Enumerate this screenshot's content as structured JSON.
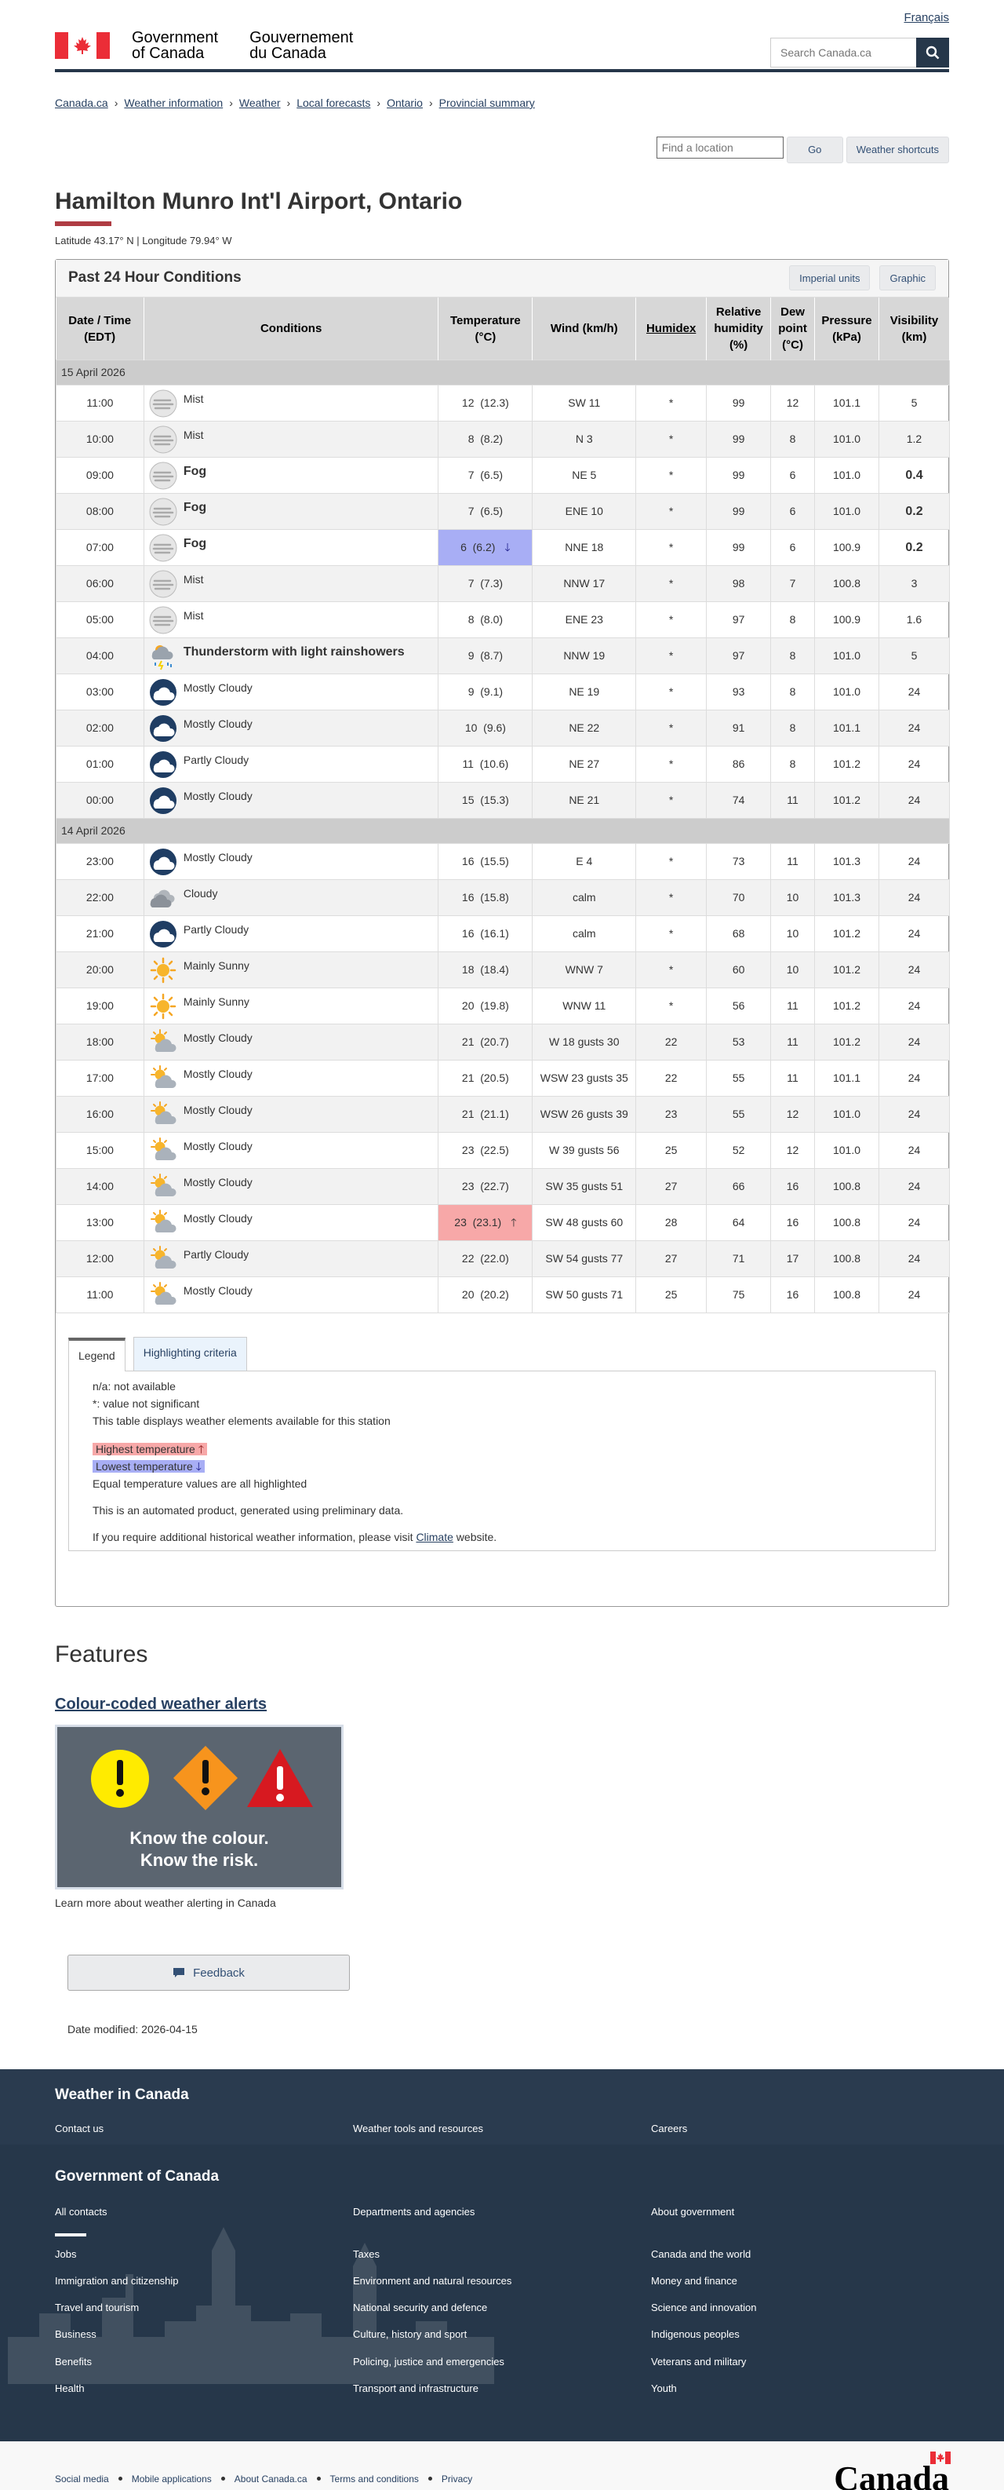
{
  "header": {
    "lang_link": "Français",
    "gov_en_1": "Government",
    "gov_en_2": "of Canada",
    "gov_fr_1": "Gouvernement",
    "gov_fr_2": "du Canada",
    "search_placeholder": "Search Canada.ca"
  },
  "breadcrumb": [
    "Canada.ca",
    "Weather information",
    "Weather",
    "Local forecasts",
    "Ontario",
    "Provincial summary"
  ],
  "location_bar": {
    "placeholder": "Find a location",
    "go": "Go",
    "shortcuts": "Weather shortcuts"
  },
  "page": {
    "title": "Hamilton Munro Int'l Airport, Ontario",
    "latlon": "Latitude 43.17° N | Longitude 79.94° W"
  },
  "panel": {
    "title": "Past 24 Hour Conditions",
    "imperial": "Imperial units",
    "graphic": "Graphic"
  },
  "table": {
    "headers": [
      "Date / Time (EDT)",
      "Conditions",
      "Temperature (°C)",
      "Wind (km/h)",
      "Humidex",
      "Relative humidity (%)",
      "Dew point (°C)",
      "Pressure (kPa)",
      "Visibility (km)"
    ],
    "groups": [
      {
        "date": "15 April 2026",
        "rows": [
          {
            "time": "11:00",
            "icon": "mist",
            "cond": "Mist",
            "bold": false,
            "temp": "12  (12.3)",
            "wind": "SW 11",
            "hx": "*",
            "rh": "99",
            "dew": "12",
            "pres": "101.1",
            "vis": "5",
            "vb": false
          },
          {
            "time": "10:00",
            "icon": "mist",
            "cond": "Mist",
            "bold": false,
            "temp": "8  (8.2)",
            "wind": "N 3",
            "hx": "*",
            "rh": "99",
            "dew": "8",
            "pres": "101.0",
            "vis": "1.2",
            "vb": false
          },
          {
            "time": "09:00",
            "icon": "mist",
            "cond": "Fog",
            "bold": true,
            "temp": "7  (6.5)",
            "wind": "NE 5",
            "hx": "*",
            "rh": "99",
            "dew": "6",
            "pres": "101.0",
            "vis": "0.4",
            "vb": true
          },
          {
            "time": "08:00",
            "icon": "mist",
            "cond": "Fog",
            "bold": true,
            "temp": "7  (6.5)",
            "wind": "ENE 10",
            "hx": "*",
            "rh": "99",
            "dew": "6",
            "pres": "101.0",
            "vis": "0.2",
            "vb": true
          },
          {
            "time": "07:00",
            "icon": "mist",
            "cond": "Fog",
            "bold": true,
            "temp": "6  (6.2)",
            "mark": "lo",
            "wind": "NNE 18",
            "hx": "*",
            "rh": "99",
            "dew": "6",
            "pres": "100.9",
            "vis": "0.2",
            "vb": true
          },
          {
            "time": "06:00",
            "icon": "mist",
            "cond": "Mist",
            "bold": false,
            "temp": "7  (7.3)",
            "wind": "NNW 17",
            "hx": "*",
            "rh": "98",
            "dew": "7",
            "pres": "100.8",
            "vis": "3",
            "vb": false
          },
          {
            "time": "05:00",
            "icon": "mist",
            "cond": "Mist",
            "bold": false,
            "temp": "8  (8.0)",
            "wind": "ENE 23",
            "hx": "*",
            "rh": "97",
            "dew": "8",
            "pres": "100.9",
            "vis": "1.6",
            "vb": false
          },
          {
            "time": "04:00",
            "icon": "storm",
            "cond": "Thunderstorm with light rainshowers",
            "bold": true,
            "temp": "9  (8.7)",
            "wind": "NNW 19",
            "hx": "*",
            "rh": "97",
            "dew": "8",
            "pres": "101.0",
            "vis": "5",
            "vb": false
          },
          {
            "time": "03:00",
            "icon": "night-cloudy",
            "cond": "Mostly Cloudy",
            "bold": false,
            "temp": "9  (9.1)",
            "wind": "NE 19",
            "hx": "*",
            "rh": "93",
            "dew": "8",
            "pres": "101.0",
            "vis": "24",
            "vb": false
          },
          {
            "time": "02:00",
            "icon": "night-cloudy",
            "cond": "Mostly Cloudy",
            "bold": false,
            "temp": "10  (9.6)",
            "wind": "NE 22",
            "hx": "*",
            "rh": "91",
            "dew": "8",
            "pres": "101.1",
            "vis": "24",
            "vb": false
          },
          {
            "time": "01:00",
            "icon": "night-cloudy",
            "cond": "Partly Cloudy",
            "bold": false,
            "temp": "11  (10.6)",
            "wind": "NE 27",
            "hx": "*",
            "rh": "86",
            "dew": "8",
            "pres": "101.2",
            "vis": "24",
            "vb": false
          },
          {
            "time": "00:00",
            "icon": "night-cloudy",
            "cond": "Mostly Cloudy",
            "bold": false,
            "temp": "15  (15.3)",
            "wind": "NE 21",
            "hx": "*",
            "rh": "74",
            "dew": "11",
            "pres": "101.2",
            "vis": "24",
            "vb": false
          }
        ]
      },
      {
        "date": "14 April 2026",
        "rows": [
          {
            "time": "23:00",
            "icon": "night-cloudy",
            "cond": "Mostly Cloudy",
            "bold": false,
            "temp": "16  (15.5)",
            "wind": "E 4",
            "hx": "*",
            "rh": "73",
            "dew": "11",
            "pres": "101.3",
            "vis": "24",
            "vb": false
          },
          {
            "time": "22:00",
            "icon": "cloudy",
            "cond": "Cloudy",
            "bold": false,
            "temp": "16  (15.8)",
            "wind": "calm",
            "hx": "*",
            "rh": "70",
            "dew": "10",
            "pres": "101.3",
            "vis": "24",
            "vb": false
          },
          {
            "time": "21:00",
            "icon": "night-cloudy",
            "cond": "Partly Cloudy",
            "bold": false,
            "temp": "16  (16.1)",
            "wind": "calm",
            "hx": "*",
            "rh": "68",
            "dew": "10",
            "pres": "101.2",
            "vis": "24",
            "vb": false
          },
          {
            "time": "20:00",
            "icon": "sunny",
            "cond": "Mainly Sunny",
            "bold": false,
            "temp": "18  (18.4)",
            "wind": "WNW 7",
            "hx": "*",
            "rh": "60",
            "dew": "10",
            "pres": "101.2",
            "vis": "24",
            "vb": false
          },
          {
            "time": "19:00",
            "icon": "sunny",
            "cond": "Mainly Sunny",
            "bold": false,
            "temp": "20  (19.8)",
            "wind": "WNW 11",
            "hx": "*",
            "rh": "56",
            "dew": "11",
            "pres": "101.2",
            "vis": "24",
            "vb": false
          },
          {
            "time": "18:00",
            "icon": "sun-cloud",
            "cond": "Mostly Cloudy",
            "bold": false,
            "temp": "21  (20.7)",
            "wind": "W 18 gusts 30",
            "hx": "22",
            "rh": "53",
            "dew": "11",
            "pres": "101.2",
            "vis": "24",
            "vb": false
          },
          {
            "time": "17:00",
            "icon": "sun-cloud",
            "cond": "Mostly Cloudy",
            "bold": false,
            "temp": "21  (20.5)",
            "wind": "WSW 23 gusts 35",
            "hx": "22",
            "rh": "55",
            "dew": "11",
            "pres": "101.1",
            "vis": "24",
            "vb": false
          },
          {
            "time": "16:00",
            "icon": "sun-cloud",
            "cond": "Mostly Cloudy",
            "bold": false,
            "temp": "21  (21.1)",
            "wind": "WSW 26 gusts 39",
            "hx": "23",
            "rh": "55",
            "dew": "12",
            "pres": "101.0",
            "vis": "24",
            "vb": false
          },
          {
            "time": "15:00",
            "icon": "sun-cloud",
            "cond": "Mostly Cloudy",
            "bold": false,
            "temp": "23  (22.5)",
            "wind": "W 39 gusts 56",
            "hx": "25",
            "rh": "52",
            "dew": "12",
            "pres": "101.0",
            "vis": "24",
            "vb": false
          },
          {
            "time": "14:00",
            "icon": "sun-cloud",
            "cond": "Mostly Cloudy",
            "bold": false,
            "temp": "23  (22.7)",
            "wind": "SW 35 gusts 51",
            "hx": "27",
            "rh": "66",
            "dew": "16",
            "pres": "100.8",
            "vis": "24",
            "vb": false
          },
          {
            "time": "13:00",
            "icon": "sun-cloud",
            "cond": "Mostly Cloudy",
            "bold": false,
            "temp": "23  (23.1)",
            "mark": "hi",
            "wind": "SW 48 gusts 60",
            "hx": "28",
            "rh": "64",
            "dew": "16",
            "pres": "100.8",
            "vis": "24",
            "vb": false
          },
          {
            "time": "12:00",
            "icon": "sun-cloud",
            "cond": "Partly Cloudy",
            "bold": false,
            "temp": "22  (22.0)",
            "wind": "SW 54 gusts 77",
            "hx": "27",
            "rh": "71",
            "dew": "17",
            "pres": "100.8",
            "vis": "24",
            "vb": false
          },
          {
            "time": "11:00",
            "icon": "sun-cloud",
            "cond": "Mostly Cloudy",
            "bold": false,
            "temp": "20  (20.2)",
            "wind": "SW 50 gusts 71",
            "hx": "25",
            "rh": "75",
            "dew": "16",
            "pres": "100.8",
            "vis": "24",
            "vb": false
          }
        ]
      }
    ]
  },
  "legend": {
    "tab1": "Legend",
    "tab2": "Highlighting criteria",
    "na": "n/a: not available",
    "star": "*: value not significant",
    "elements": "This table displays weather elements available for this station",
    "highest": "Highest temperature",
    "lowest": "Lowest temperature",
    "equal": "Equal temperature values are all highlighted",
    "automated": "This is an automated product, generated using preliminary data.",
    "historical_pre": "If you require additional historical weather information, please visit",
    "historical_link": "Climate",
    "historical_post": "website."
  },
  "features": {
    "title": "Features",
    "alert_link": "Colour-coded weather alerts",
    "img_line1": "Know the colour.",
    "img_line2": "Know the risk.",
    "caption": "Learn more about weather alerting in Canada",
    "feedback": "Feedback",
    "date_modified": "Date modified: 2026-04-15"
  },
  "footer": {
    "weather_title": "Weather in Canada",
    "weather_links": [
      "Contact us",
      "Weather tools and resources",
      "Careers"
    ],
    "gov_title": "Government of Canada",
    "gov_top": [
      "All contacts",
      "Departments and agencies",
      "About government"
    ],
    "gov_links": [
      "Jobs",
      "Taxes",
      "Canada and the world",
      "Immigration and citizenship",
      "Environment and natural resources",
      "Money and finance",
      "Travel and tourism",
      "National security and defence",
      "Science and innovation",
      "Business",
      "Culture, history and sport",
      "Indigenous peoples",
      "Benefits",
      "Policing, justice and emergencies",
      "Veterans and military",
      "Health",
      "Transport and infrastructure",
      "Youth"
    ],
    "bottom_links": [
      "Social media",
      "Mobile applications",
      "About Canada.ca",
      "Terms and conditions",
      "Privacy"
    ],
    "wordmark": "Canada"
  },
  "colors": {
    "header_bar": "#26374a",
    "accent": "#af3c43",
    "highest": "#f7a8a8",
    "lowest": "#a8aef5"
  }
}
